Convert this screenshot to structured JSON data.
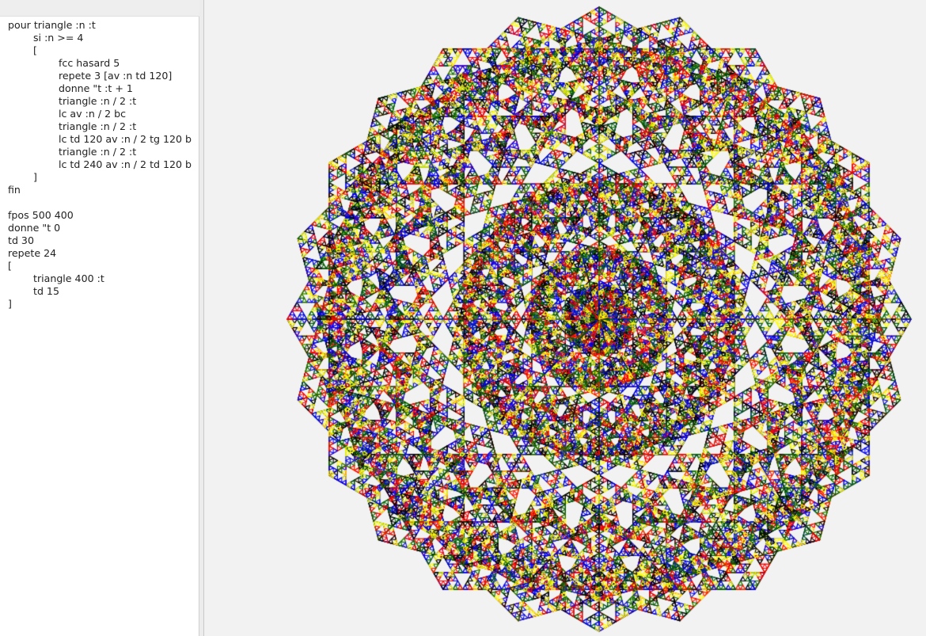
{
  "editor": {
    "code_lines": [
      "pour triangle :n :t",
      "\tsi :n >= 4",
      "\t[",
      "\t\tfcc hasard 5",
      "\t\trepete 3 [av :n td 120]",
      "\t\tdonne \"t :t + 1",
      "\t\ttriangle :n / 2 :t",
      "\t\tlc av :n / 2 bc",
      "\t\ttriangle :n / 2 :t",
      "\t\tlc td 120 av :n / 2 tg 120 b",
      "\t\ttriangle :n / 2 :t",
      "\t\tlc td 240 av :n / 2 td 120 b",
      "\t]",
      "fin",
      "",
      "fpos 500 400",
      "donne \"t 0",
      "td 30",
      "repete 24",
      "[",
      "\ttriangle 400 :t",
      "\ttd 15",
      "]"
    ]
  },
  "canvas": {
    "background": "#f2f2f2",
    "palette": [
      "#000000",
      "#ff0000",
      "#006400",
      "#ffff00",
      "#0000ff"
    ],
    "program": {
      "start": [
        500,
        400
      ],
      "initial_heading": 30,
      "repeats": 24,
      "turn": 15,
      "triangle_size": 400,
      "min_size": 4
    }
  }
}
